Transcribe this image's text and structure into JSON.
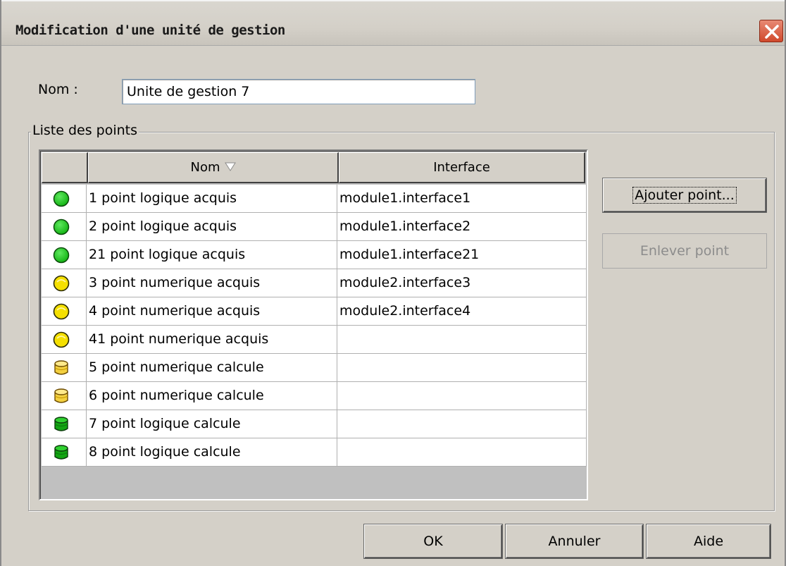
{
  "window": {
    "title": "Modification d'une unité de gestion",
    "close_icon": "close-icon"
  },
  "form": {
    "name_label": "Nom :",
    "name_value": "Unite de gestion 7"
  },
  "points_group": {
    "title": "Liste des points",
    "table": {
      "columns": [
        "",
        "Nom",
        "Interface"
      ],
      "sort_icon": "sort-descending-icon",
      "rows": [
        {
          "icon": "green-circle-icon",
          "nom": "1 point logique acquis",
          "interface": "module1.interface1"
        },
        {
          "icon": "green-circle-icon",
          "nom": "2 point logique acquis",
          "interface": "module1.interface2"
        },
        {
          "icon": "green-circle-icon",
          "nom": "21 point logique acquis",
          "interface": "module1.interface21"
        },
        {
          "icon": "yellow-circle-icon",
          "nom": "3 point numerique acquis",
          "interface": "module2.interface3"
        },
        {
          "icon": "yellow-circle-icon",
          "nom": "4 point numerique acquis",
          "interface": "module2.interface4"
        },
        {
          "icon": "yellow-circle-icon",
          "nom": "41 point numerique acquis",
          "interface": ""
        },
        {
          "icon": "yellow-cylinder-icon",
          "nom": "5 point numerique calcule",
          "interface": ""
        },
        {
          "icon": "yellow-cylinder-icon",
          "nom": "6 point numerique calcule",
          "interface": ""
        },
        {
          "icon": "green-cylinder-icon",
          "nom": "7 point logique calcule",
          "interface": ""
        },
        {
          "icon": "green-cylinder-icon",
          "nom": "8 point logique calcule",
          "interface": ""
        }
      ]
    },
    "add_button": "Ajouter point...",
    "remove_button": "Enlever point"
  },
  "footer": {
    "ok": "OK",
    "cancel": "Annuler",
    "help": "Aide"
  },
  "colors": {
    "green": "#14b414",
    "yellow": "#f5e000",
    "cylinder_yellow": "#f3d040",
    "window_bg": "#d4d0c8"
  }
}
